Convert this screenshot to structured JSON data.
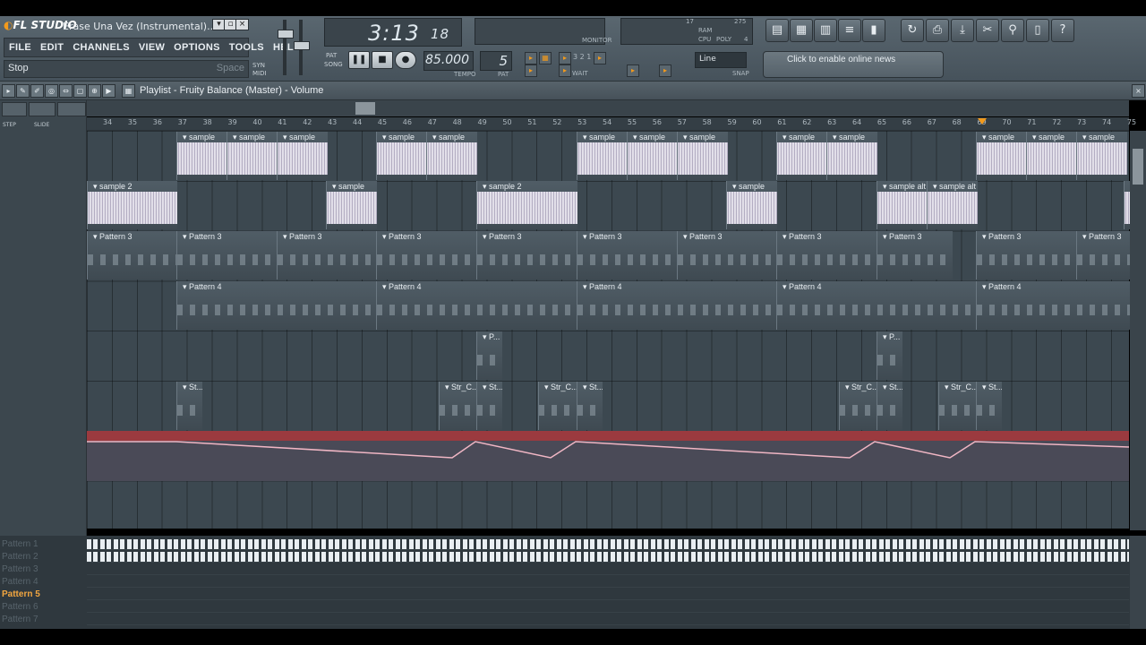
{
  "app": {
    "brand": "FL STUDIO",
    "title": "Érase Una Vez (Instrumental)...."
  },
  "menu": [
    "FILE",
    "EDIT",
    "CHANNELS",
    "VIEW",
    "OPTIONS",
    "TOOLS",
    "HELP"
  ],
  "hint": {
    "text": "Stop",
    "shortcut": "Space"
  },
  "transport": {
    "time": "3:13",
    "ticks": "18",
    "tempo": "85.000",
    "pattern": "5",
    "tempo_label": "TEMPO",
    "pattern_label": "PAT",
    "mode_pat": "PAT",
    "mode_song": "SONG",
    "syn": "SYN",
    "midi": "MIDI",
    "monitor": "MONITOR",
    "cpu": "CPU",
    "ram": "RAM",
    "poly": "POLY",
    "cpu_val": "17",
    "poly_val": "275",
    "poly_sub": "4",
    "snap_value": "Line",
    "snap_label": "SNAP",
    "wait": "WAIT"
  },
  "news": "Click to enable online news",
  "playlist": {
    "title": "Playlist - Fruity Balance (Master) - Volume",
    "step": "STEP",
    "slide": "SLIDE"
  },
  "ruler": [
    "34",
    "35",
    "36",
    "37",
    "38",
    "39",
    "40",
    "41",
    "42",
    "43",
    "44",
    "45",
    "46",
    "47",
    "48",
    "49",
    "50",
    "51",
    "52",
    "53",
    "54",
    "55",
    "56",
    "57",
    "58",
    "59",
    "60",
    "61",
    "62",
    "63",
    "64",
    "65",
    "66",
    "67",
    "68",
    "69",
    "70",
    "71",
    "72",
    "73",
    "74",
    "75"
  ],
  "clips": {
    "sample": "sample",
    "sample2": "sample 2",
    "sample_alt": "sample alt",
    "pattern3": "Pattern 3",
    "pattern4": "Pattern 4",
    "p_short": "P...",
    "st_short": "St...",
    "str_c": "Str_C..."
  },
  "patterns": [
    "Pattern 1",
    "Pattern 2",
    "Pattern 3",
    "Pattern 4",
    "Pattern 5",
    "Pattern 6",
    "Pattern 7"
  ],
  "active_pattern": "Pattern 5",
  "colors": {
    "accent": "#f29a1c",
    "automation": "#9b3a3f",
    "curve": "#f0b6c4"
  }
}
